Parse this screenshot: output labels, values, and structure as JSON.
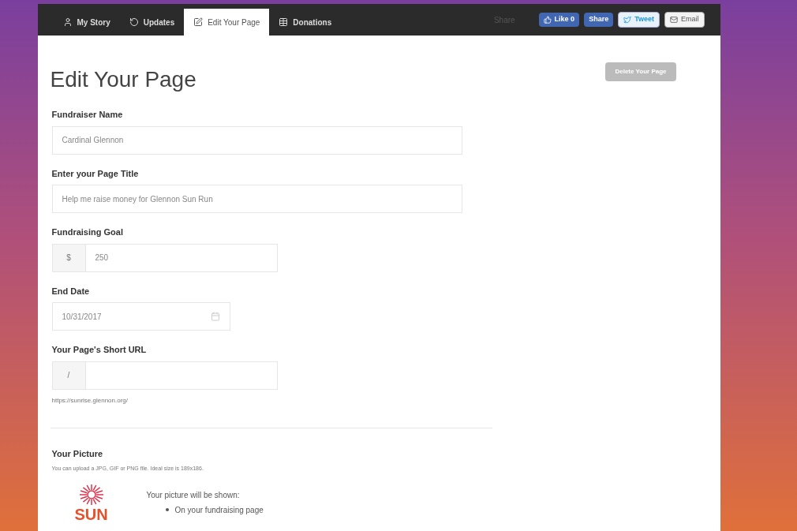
{
  "tabs": [
    {
      "label": "My Story",
      "kind": "user",
      "selected": false
    },
    {
      "label": "Updates",
      "kind": "refresh",
      "selected": false
    },
    {
      "label": "Edit Your Page",
      "kind": "edit",
      "selected": true
    },
    {
      "label": "Donations",
      "kind": "table",
      "selected": false
    }
  ],
  "share": {
    "label": "Share",
    "buttons": [
      {
        "kind": "like",
        "label": "Like 0"
      },
      {
        "kind": "fbshare",
        "label": "Share"
      },
      {
        "kind": "tweet",
        "label": "Tweet"
      },
      {
        "kind": "email",
        "label": "Email"
      }
    ]
  },
  "title": "Edit Your Page",
  "delete_button": "Delete Your Page",
  "fields": [
    {
      "kind": "text",
      "label": "Fundraiser Name",
      "value": "Cardinal Glennon"
    },
    {
      "kind": "text",
      "label": "Enter your Page Title",
      "value": "Help me raise money for Glennon Sun Run"
    },
    {
      "kind": "addon",
      "label": "Fundraising Goal",
      "addon": "$",
      "value": "250"
    },
    {
      "kind": "date",
      "label": "End Date",
      "value": "10/31/2017"
    },
    {
      "kind": "addon",
      "label": "Your Page's Short URL",
      "addon": "/",
      "help": "https://sunrise.glennon.org/"
    }
  ],
  "picture": {
    "heading": "Your Picture",
    "note": "You can upload a JPG, GIF or PNG file. Ideal size is 189x186.",
    "logo_text": "SUN",
    "shown_heading": "Your picture will be shown:",
    "shown_list": [
      "On your fundraising page"
    ]
  }
}
